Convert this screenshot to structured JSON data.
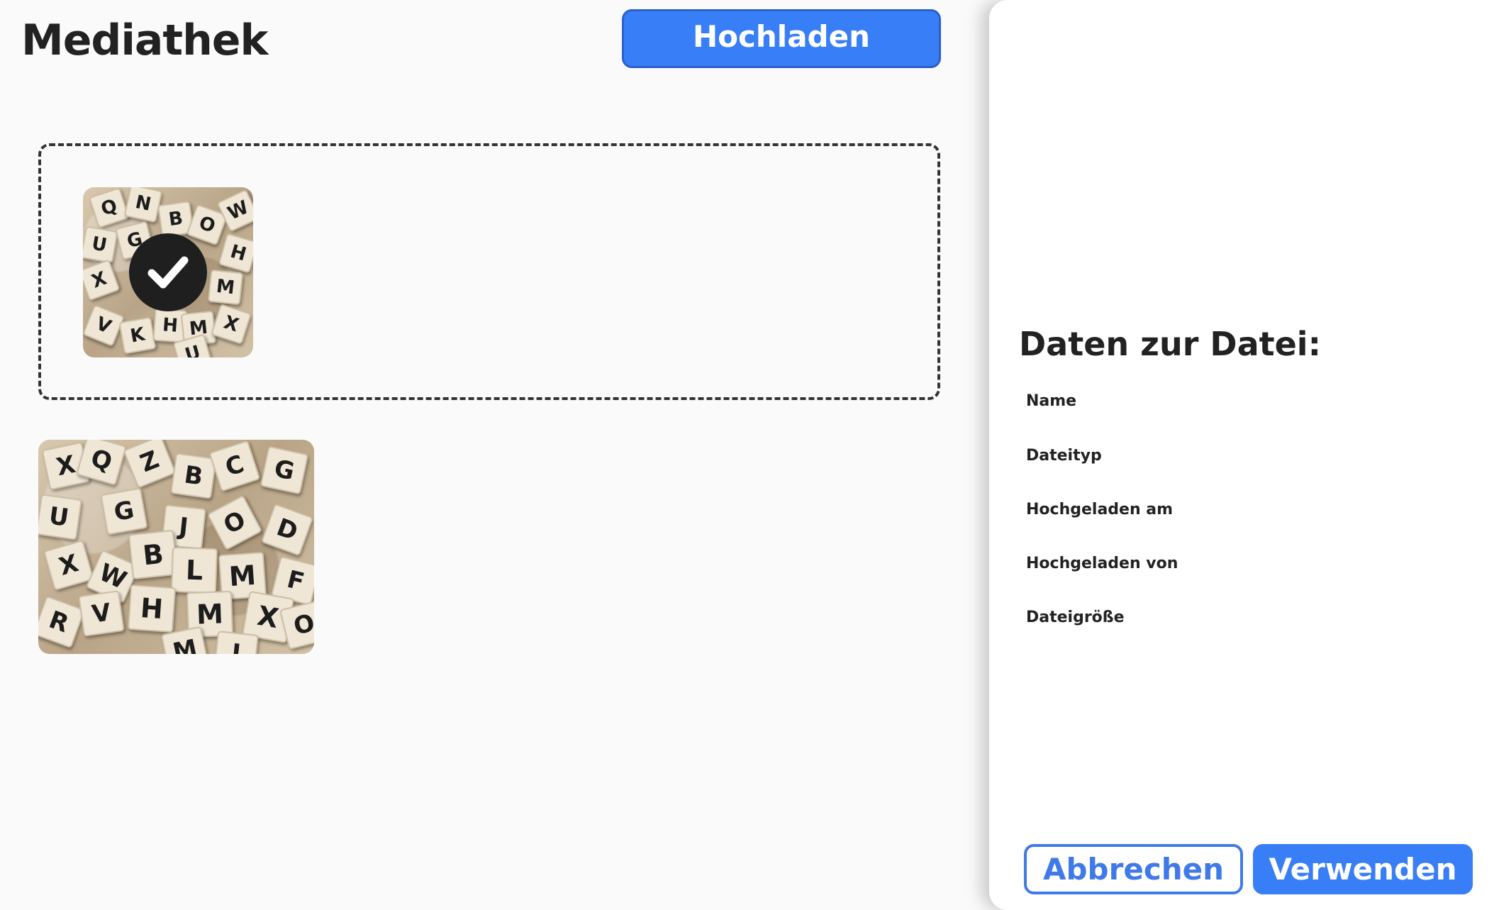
{
  "library": {
    "title": "Mediathek",
    "upload_label": "Hochladen",
    "selected_image": {
      "selected": true,
      "icon": "checkmark-icon"
    },
    "images": [
      {
        "name": "scrabble-letters-image"
      }
    ]
  },
  "details": {
    "title": "Daten zur Datei:",
    "fields": [
      {
        "label": "Name"
      },
      {
        "label": "Dateityp"
      },
      {
        "label": "Hochgeladen am"
      },
      {
        "label": "Hochgeladen von"
      },
      {
        "label": "Dateigröße"
      }
    ],
    "cancel_label": "Abbrechen",
    "use_label": "Verwenden"
  },
  "colors": {
    "accent": "#387ef7",
    "background": "#fafafa",
    "panel": "#ffffff"
  }
}
